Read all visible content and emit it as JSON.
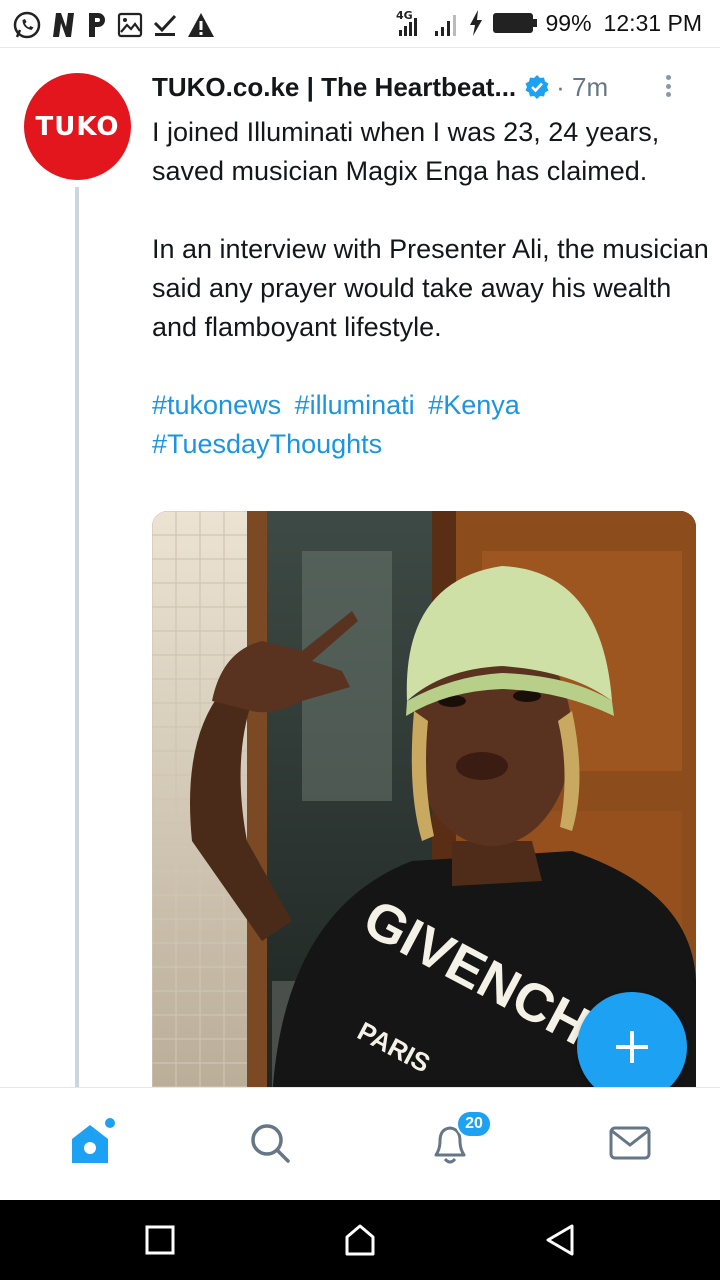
{
  "status_bar": {
    "left_icons": [
      "whatsapp-icon",
      "nation-n-icon",
      "p-icon",
      "gallery-icon",
      "download-done-icon",
      "warning-icon"
    ],
    "network": "4G",
    "battery": "99%",
    "time": "12:31 PM"
  },
  "tweet": {
    "avatar_text": "TUKO",
    "display_name": "TUKO.co.ke | The Heartbeat...",
    "time_ago": "· 7m",
    "paragraphs": [
      "I joined Illuminati when I was 23, 24 years, saved musician Magix Enga has claimed.",
      "In an interview with Presenter Ali, the musician said any prayer would take away his wealth and flamboyant lifestyle."
    ],
    "hashtags": [
      "#tukonews",
      "#illuminati",
      "#Kenya",
      "#TuesdayThoughts"
    ],
    "media": {
      "shirt_text_1": "GIVENCHY",
      "shirt_text_2": "PARIS"
    }
  },
  "colors": {
    "brand": "#1da1f2",
    "link": "#1b95e0",
    "tuko_red": "#e4161d"
  },
  "bottom_nav": {
    "items": [
      "home-icon",
      "search-icon",
      "notifications-icon",
      "messages-icon"
    ],
    "notification_count": "20"
  },
  "android_nav": [
    "recents-icon",
    "home-icon",
    "back-icon"
  ]
}
